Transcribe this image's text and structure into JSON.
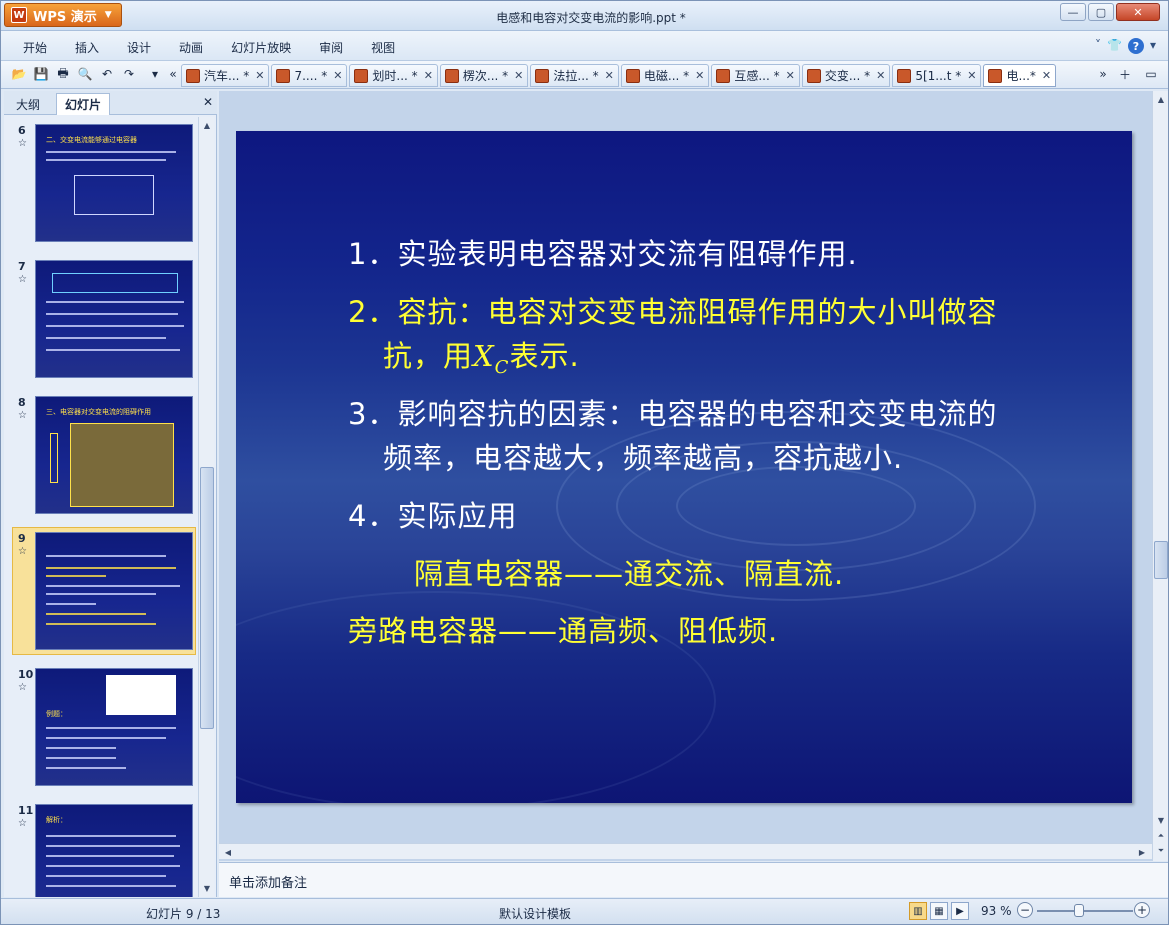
{
  "app": {
    "name": "WPS 演示",
    "window_title": "电感和电容对交变电流的影响.ppt *"
  },
  "menu": [
    "开始",
    "插入",
    "设计",
    "动画",
    "幻灯片放映",
    "审阅",
    "视图"
  ],
  "doc_tabs": [
    {
      "label": "汽车... *",
      "active": false
    },
    {
      "label": "7.... *",
      "active": false
    },
    {
      "label": "划时... *",
      "active": false
    },
    {
      "label": "楞次... *",
      "active": false
    },
    {
      "label": "法拉... *",
      "active": false
    },
    {
      "label": "电磁... *",
      "active": false
    },
    {
      "label": "互感... *",
      "active": false
    },
    {
      "label": "交变... *",
      "active": false
    },
    {
      "label": "5[1...t *",
      "active": false
    },
    {
      "label": "电...*",
      "active": true
    }
  ],
  "panel": {
    "tab_outline": "大纲",
    "tab_slides": "幻灯片"
  },
  "thumbnails": [
    {
      "num": "6",
      "title": "二、交变电流能够通过电容器",
      "selected": false
    },
    {
      "num": "7",
      "title": "“通交流、隔直流”",
      "selected": false
    },
    {
      "num": "8",
      "title": "三、电容器对交变电流的阻碍作用",
      "selected": false
    },
    {
      "num": "9",
      "title": "1. 实验表明电容器对交流有阻碍作用.",
      "selected": true
    },
    {
      "num": "10",
      "title": "例题：",
      "selected": false
    },
    {
      "num": "11",
      "title": "解析：",
      "selected": false
    }
  ],
  "slide": {
    "l1": "1．实验表明电容器对交流有阻碍作用.",
    "l2a": "2．容抗：电容对交变电流阻碍作用的大小叫做容",
    "l2b_pre": "抗，用",
    "l2b_x": "X",
    "l2b_sub": "C",
    "l2b_post": "表示.",
    "l3a": "3．影响容抗的因素：电容器的电容和交变电流的",
    "l3b": "频率，电容越大，频率越高，容抗越小.",
    "l4": "4．实际应用",
    "l5": "隔直电容器——通交流、隔直流.",
    "l6": "旁路电容器——通高频、阻低频."
  },
  "notes": "单击添加备注",
  "status": {
    "slide_info": "幻灯片 9 / 13",
    "template": "默认设计模板",
    "zoom": "93 %"
  },
  "colors": {
    "slide_bg": "#13258c",
    "highlight_text": "#ffff33",
    "body_text": "#ffffff"
  }
}
